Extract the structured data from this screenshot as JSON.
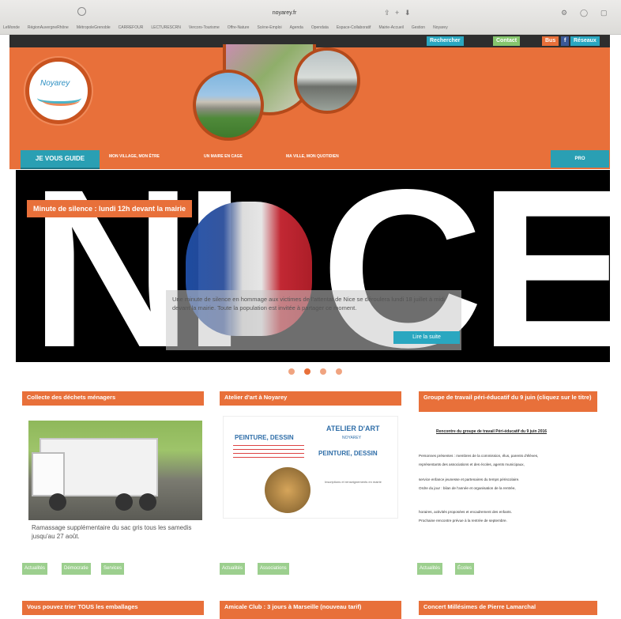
{
  "browser": {
    "url": "noyarey.fr",
    "bookmarks": [
      "LeMonde",
      "RégionAuvergneRhône",
      "MétropoleGrenoble",
      "CARREFOUR",
      "LECTURESCRN",
      "Vercors-Tourisme",
      "Offre-Nature",
      "Scène-Emploi",
      "Agenda",
      "Opendata",
      "Espace-Collaboratif",
      "Mairie-Accueil",
      "Gestion",
      "Noyarey"
    ]
  },
  "topbar": {
    "search": "Rechercher",
    "contact": "Contact",
    "bus": "Bus",
    "networks": "Réseaux",
    "facebook": "f"
  },
  "logo": {
    "text": "Noyarey"
  },
  "nav": {
    "guide": "JE VOUS GUIDE",
    "items": [
      "MON VILLAGE, MON ÊTRE",
      "UN MAIRE EN CAGE",
      "MA VILLE, MON QUOTIDIEN"
    ],
    "pro": "PRO"
  },
  "slider": {
    "letters": [
      "N",
      "I",
      "C",
      "E"
    ],
    "caption": "Minute de silence : lundi 12h devant la mairie",
    "overlay_text": "Une minute de silence en hommage aux victimes de l'attentat de Nice se déroulera lundi 18 juillet à midi devant la mairie. Toute la population est invitée à partager ce moment.",
    "read_more": "Lire la suite",
    "dots_count": 4,
    "active_dot": 1
  },
  "cards": [
    {
      "title": "Collecte des déchets ménagers",
      "text": "Ramassage supplémentaire du sac gris tous les samedis jusqu'au 27 août.",
      "tags": [
        "Actualités",
        "Démocratie",
        "Services"
      ]
    },
    {
      "title": "Atelier d'art à Noyarey",
      "poster_title": "ATELIER D'ART",
      "poster_subtitle": "NOYAREY",
      "poster_line": "PEINTURE, DESSIN",
      "poster_small": "Inscriptions et renseignements en mairie",
      "tags": [
        "Actualités",
        "Associations"
      ]
    },
    {
      "title": "Groupe de travail péri-éducatif du 9 juin (cliquez sur le titre)",
      "heading": "Rencontre du groupe de travail Péri-éducatif du 9 juin 2016",
      "lines": [
        "Personnes présentes : membres de la commission, élus, parents d'élèves,",
        "représentants des associations et des écoles, agents municipaux,",
        "service enfance jeunesse et partenaires du temps périscolaire.",
        "Ordre du jour : bilan de l'année et organisation de la rentrée,",
        "horaires, activités proposées et encadrement des enfants.",
        "Prochaine rencontre prévue à la rentrée de septembre."
      ],
      "tags": [
        "Actualités",
        "Écoles"
      ]
    }
  ],
  "bottom_cards": [
    {
      "title": "Vous pouvez trier TOUS les emballages"
    },
    {
      "title": "Amicale Club : 3 jours à Marseille (nouveau tarif)"
    },
    {
      "title": "Concert Millésimes de Pierre Lamarchal"
    }
  ]
}
